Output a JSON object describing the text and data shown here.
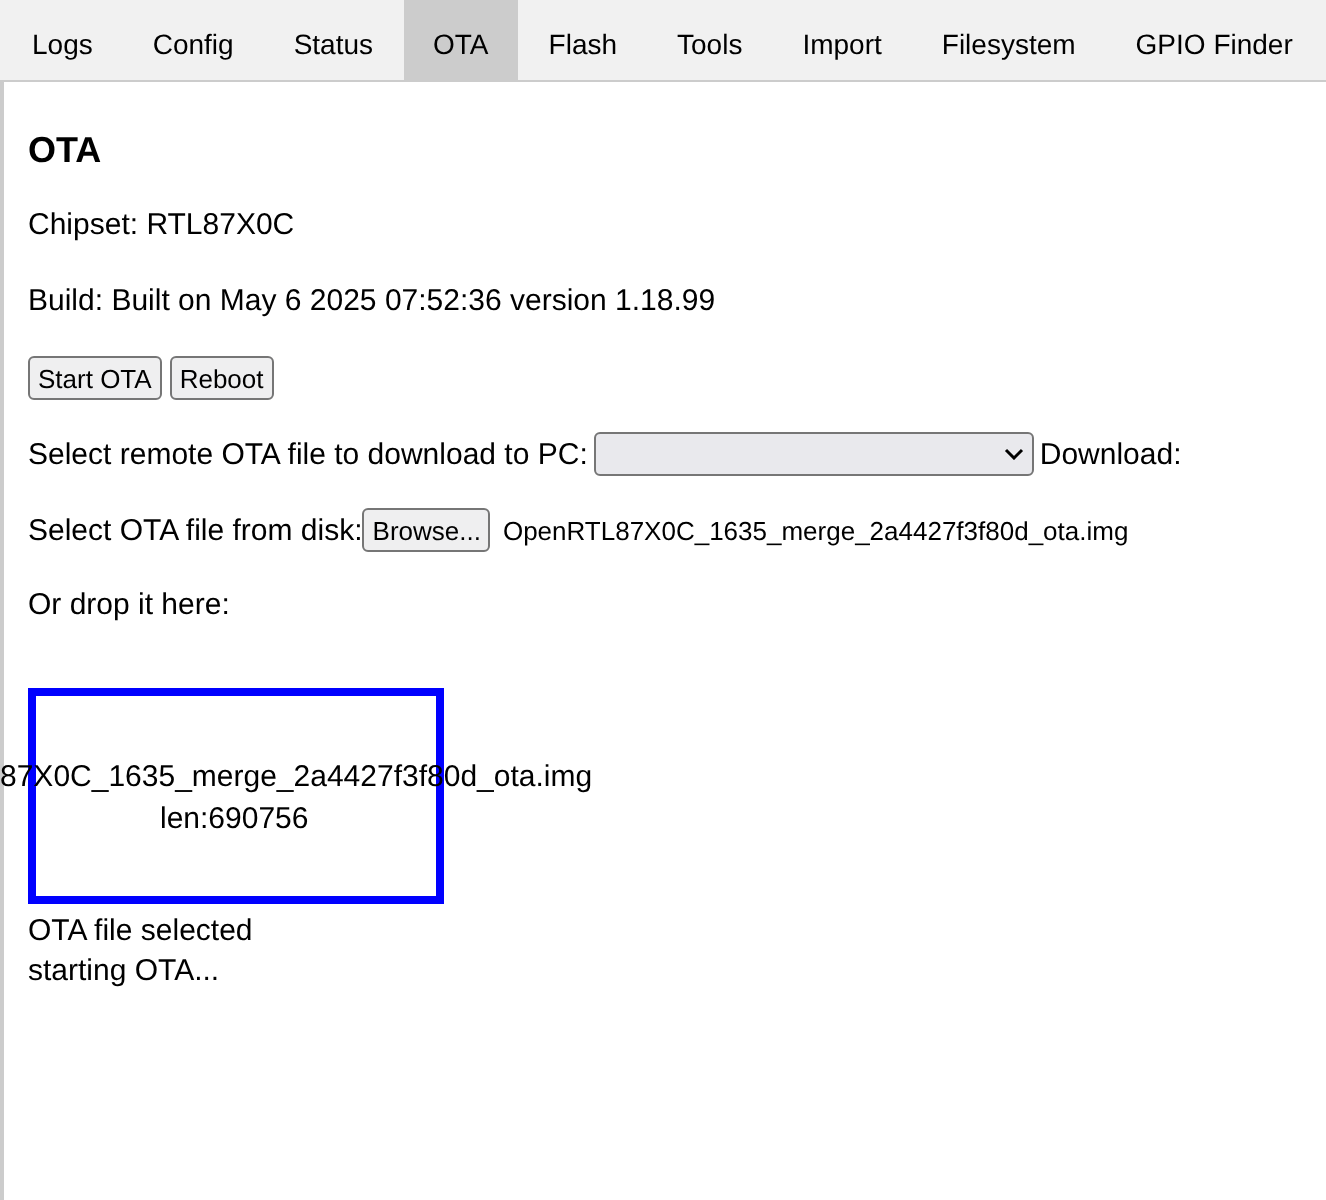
{
  "tabs": [
    {
      "label": "Logs",
      "selected": false
    },
    {
      "label": "Config",
      "selected": false
    },
    {
      "label": "Status",
      "selected": false
    },
    {
      "label": "OTA",
      "selected": true
    },
    {
      "label": "Flash",
      "selected": false
    },
    {
      "label": "Tools",
      "selected": false
    },
    {
      "label": "Import",
      "selected": false
    },
    {
      "label": "Filesystem",
      "selected": false
    },
    {
      "label": "GPIO Finder",
      "selected": false
    }
  ],
  "heading": "OTA",
  "chipset": "Chipset: RTL87X0C",
  "build": "Build: Built on May 6 2025 07:52:36 version 1.18.99",
  "buttons": [
    "Start OTA",
    "Reboot"
  ],
  "remote": {
    "label": "Select remote OTA file to download to PC:",
    "download": "Download:"
  },
  "disk": {
    "label": "Select OTA file from disk:",
    "browse": "Browse...",
    "filename": "OpenRTL87X0C_1635_merge_2a4427f3f80d_ota.img"
  },
  "drop_label": "Or drop it here:",
  "drop_box": {
    "filename": "87X0C_1635_merge_2a4427f3f80d_ota.img",
    "length": "len:690756"
  },
  "status_lines": [
    "OTA file selected",
    "starting OTA..."
  ]
}
